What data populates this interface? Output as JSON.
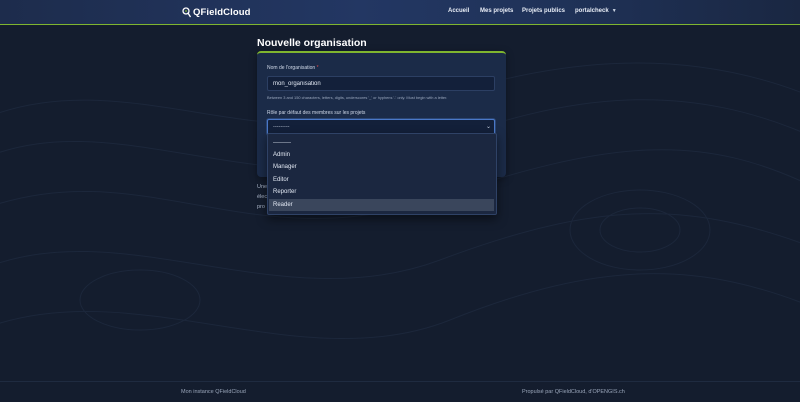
{
  "header": {
    "brand": "QFieldCloud",
    "nav": {
      "home": "Accueil",
      "my_projects": "Mes projets",
      "public_projects": "Projets publics",
      "user": "portalcheck"
    }
  },
  "main": {
    "title": "Nouvelle organisation",
    "form": {
      "name_label": "Nom de l'organisation",
      "name_required_mark": "*",
      "name_value": "mon_organisation",
      "name_help": "Between 3 and 150 characters, letters, digits, underscores '_' or hyphens '-' only. Must begin with a letter.",
      "role_label": "Rôle par défaut des membres sur les projets",
      "role_value": "---------",
      "role_options": [
        "---------",
        "Admin",
        "Manager",
        "Editor",
        "Reporter",
        "Reader"
      ],
      "highlighted_option": "Reader"
    },
    "below_text": [
      "Une",
      "élec",
      "pro"
    ]
  },
  "footer": {
    "left": "Mon instance QFieldCloud",
    "right": "Propulsé par QFieldCloud, d'OPENGIS.ch"
  },
  "colors": {
    "background": "#141d2e",
    "accent": "#7fb52f",
    "card": "#1b2b48",
    "focus": "#4a78c8"
  }
}
